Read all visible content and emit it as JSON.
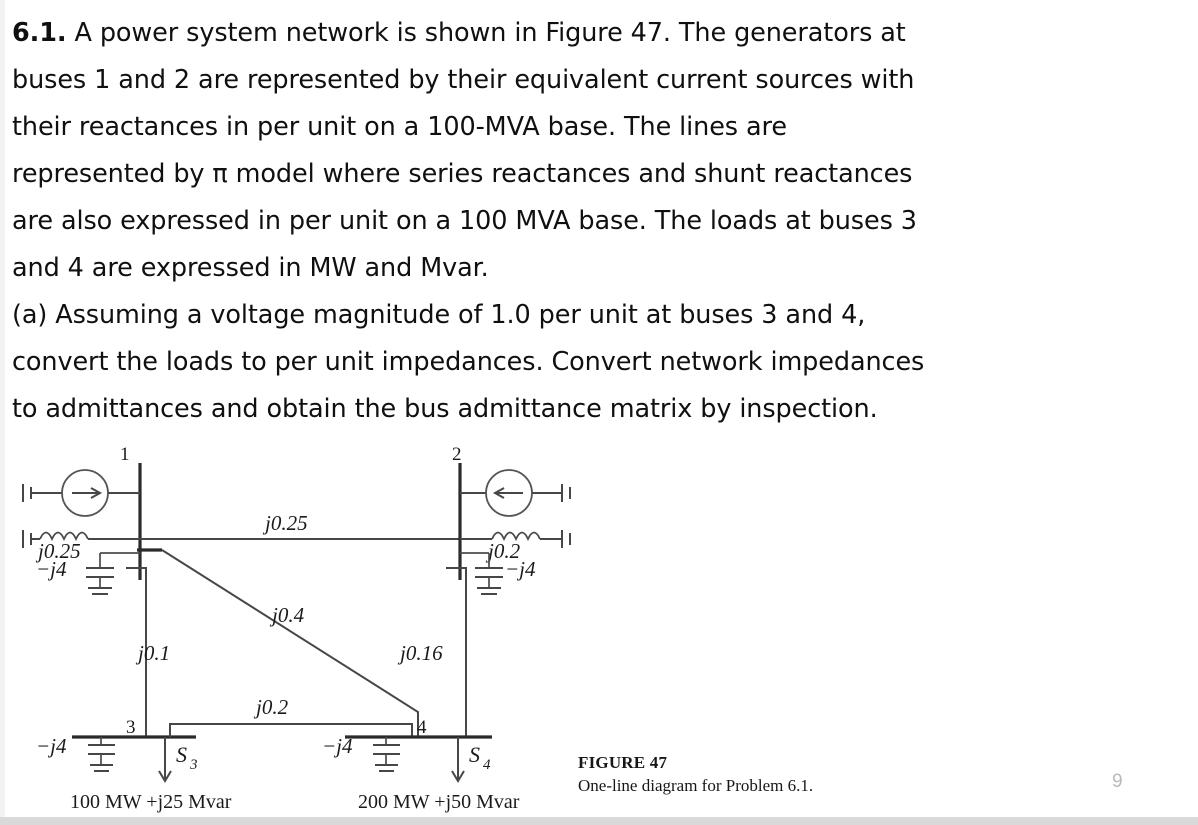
{
  "problem": {
    "number": "6.1.",
    "lines": [
      "A power system network is shown in Figure 47. The generators at",
      "buses 1 and 2 are represented by their equivalent current sources with",
      "their reactances in per unit on a 100-MVA base. The lines are",
      "represented by π model where series reactances and shunt reactances",
      "are also expressed in per unit on a 100 MVA base. The loads at buses 3",
      "and 4 are expressed in MW and Mvar.",
      "(a) Assuming a voltage magnitude of 1.0 per unit at buses 3 and 4,",
      "convert the loads to per unit impedances. Convert network impedances",
      "to admittances and obtain the bus admittance matrix by inspection."
    ],
    "full_text": "6.1. A power system network is shown in Figure 47. The generators at buses 1 and 2 are represented by their equivalent current sources with their reactances in per unit on a 100-MVA base. The lines are represented by π model where series reactances and shunt reactances are also expressed in per unit on a 100 MVA base. The loads at buses 3 and 4 are expressed in MW and Mvar. (a) Assuming a voltage magnitude of 1.0 per unit at buses 3 and 4, convert the loads to per unit impedances. Convert network impedances to admittances and obtain the bus admittance matrix by inspection."
  },
  "figure": {
    "caption_title": "FIGURE 47",
    "caption_subtitle": "One-line diagram for Problem 6.1.",
    "buses": [
      {
        "id": "1",
        "label": "1"
      },
      {
        "id": "2",
        "label": "2"
      },
      {
        "id": "3",
        "label": "3"
      },
      {
        "id": "4",
        "label": "4"
      }
    ],
    "generator_reactances": [
      {
        "bus": "1",
        "label": "j0.25"
      },
      {
        "bus": "2",
        "label": "j0.2"
      }
    ],
    "shunt_reactances": [
      {
        "bus": "1",
        "label": "−j4"
      },
      {
        "bus": "2",
        "label": "−j4"
      },
      {
        "bus": "3",
        "label": "−j4"
      },
      {
        "bus": "4",
        "label": "−j4"
      }
    ],
    "line_reactances": [
      {
        "from": "1",
        "to": "2",
        "label": "j0.25"
      },
      {
        "from": "1",
        "to": "4",
        "label": "j0.4"
      },
      {
        "from": "1",
        "to": "3",
        "label": "j0.1"
      },
      {
        "from": "2",
        "to": "4",
        "label": "j0.16"
      },
      {
        "from": "3",
        "to": "4",
        "label": "j0.2"
      }
    ],
    "loads": [
      {
        "bus": "3",
        "symbol": "S",
        "subscript": "3",
        "value": "100 MW +j25 Mvar",
        "value_mw": 100,
        "value_mvar": 25
      },
      {
        "bus": "4",
        "symbol": "S",
        "subscript": "4",
        "value": "200 MW +j50 Mvar",
        "value_mw": 200,
        "value_mvar": 50
      }
    ],
    "sources": [
      {
        "bus": "1",
        "direction": "right"
      },
      {
        "bus": "2",
        "direction": "left"
      }
    ]
  },
  "page": {
    "page_number": "9"
  },
  "colors": {
    "text": "#101010",
    "wire": "#474747",
    "bus": "#2b2b2b",
    "page_number": "#b9b9b9"
  }
}
